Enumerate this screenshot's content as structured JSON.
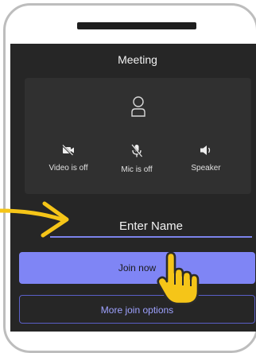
{
  "meeting": {
    "title": "Meeting",
    "avatar_icon": "person-outline-icon",
    "controls": [
      {
        "label": "Video is off",
        "icon": "video-off-icon"
      },
      {
        "label": "Mic is off",
        "icon": "mic-off-icon"
      },
      {
        "label": "Speaker",
        "icon": "speaker-icon"
      }
    ]
  },
  "join_form": {
    "name_placeholder": "Enter Name",
    "name_value": "",
    "join_label": "Join now",
    "more_options_label": "More join options"
  },
  "annotations": {
    "arrow_icon": "pointing-arrow-icon",
    "cursor_icon": "hand-pointer-icon"
  },
  "colors": {
    "screen_bg": "#262626",
    "preview_bg": "#303030",
    "accent": "#7f85f5",
    "accent_text": "#9ea2ff",
    "annotation": "#f5c518"
  }
}
